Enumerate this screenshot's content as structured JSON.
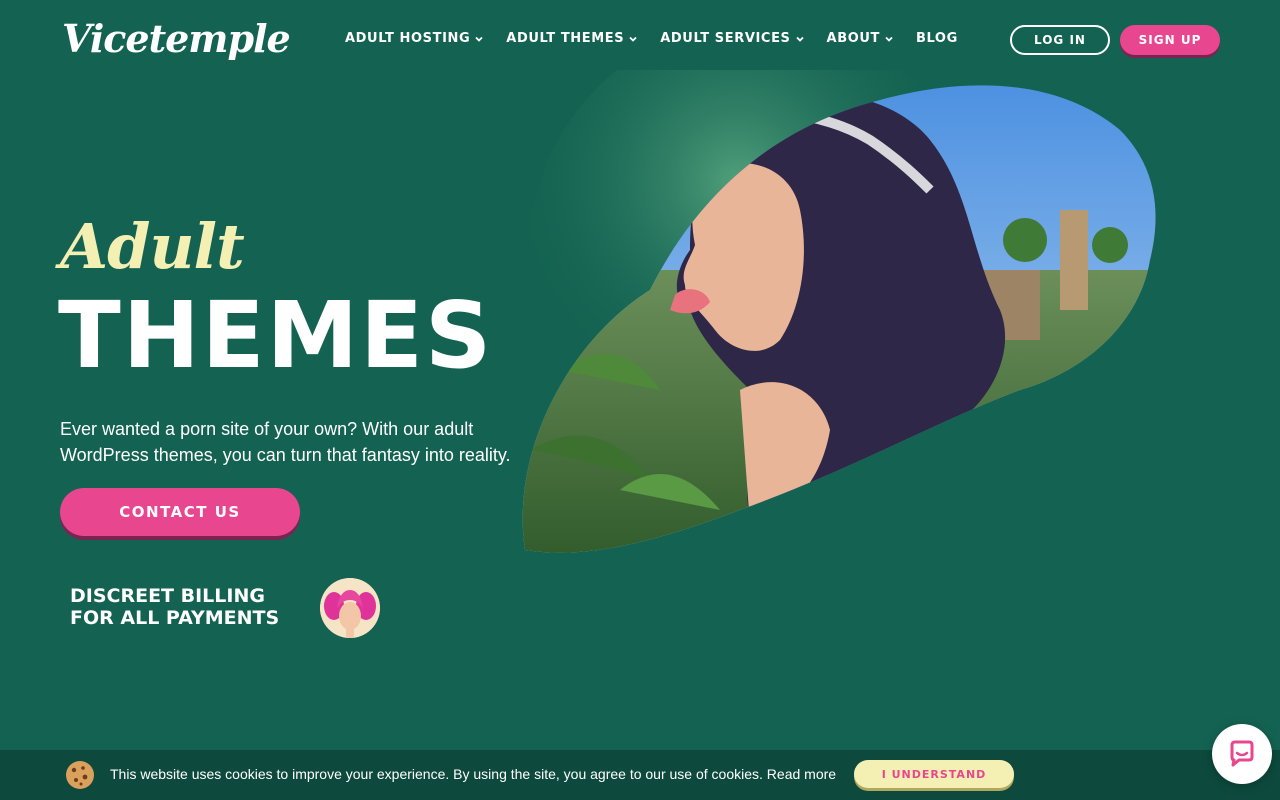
{
  "header": {
    "logo_text": "Vicetemple",
    "nav": [
      {
        "label": "ADULT HOSTING",
        "has_dropdown": true
      },
      {
        "label": "ADULT THEMES",
        "has_dropdown": true
      },
      {
        "label": "ADULT SERVICES",
        "has_dropdown": true
      },
      {
        "label": "ABOUT",
        "has_dropdown": true
      },
      {
        "label": "BLOG",
        "has_dropdown": false
      }
    ],
    "login_label": "LOG IN",
    "signup_label": "SIGN UP"
  },
  "hero": {
    "script_title": "Adult",
    "title": "THEMES",
    "description": "Ever wanted a porn site of your own? With our adult WordPress themes, you can turn that fantasy into reality.",
    "contact_label": "CONTACT US",
    "billing_text": "DISCREET BILLING FOR ALL PAYMENTS"
  },
  "cookie": {
    "text": "This website uses cookies to improve your experience. By using the site, you agree to our use of cookies.",
    "read_more": "Read more",
    "accept_label": "I UNDERSTAND"
  },
  "colors": {
    "background": "#146352",
    "accent_pink": "#e8478f",
    "accent_cream": "#f4f0b4",
    "cookie_bar": "#0d4a3d"
  },
  "icons": {
    "nav_dropdown": "chevron-down-icon",
    "cookie": "cookie-icon",
    "chat": "chat-bubble-icon"
  }
}
